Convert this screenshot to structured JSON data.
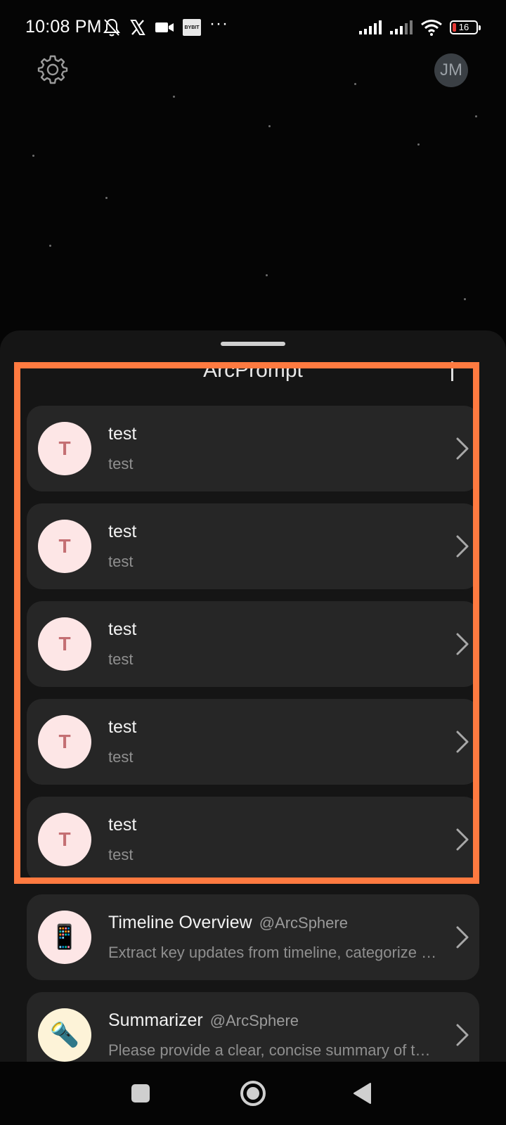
{
  "status_bar": {
    "time": "10:08 PM",
    "left_icons": [
      "bell-off-icon",
      "x-logo-icon",
      "video-camera-icon",
      "bybit-icon",
      "more-dots-icon"
    ],
    "bybit_label": "BYBIT",
    "dots": "···",
    "right_icons": [
      "signal-icon",
      "signal-icon",
      "wifi-icon",
      "battery-icon"
    ],
    "battery_level": "16",
    "battery_color": "#e53935"
  },
  "top_bar": {
    "settings_icon": "gear-icon",
    "avatar_initials": "JM"
  },
  "sheet": {
    "title": "ArcPrompt",
    "add_icon": "plus-icon"
  },
  "prompts": [
    {
      "initial": "T",
      "title": "test",
      "author": "",
      "subtitle": "test"
    },
    {
      "initial": "T",
      "title": "test",
      "author": "",
      "subtitle": "test"
    },
    {
      "initial": "T",
      "title": "test",
      "author": "",
      "subtitle": "test"
    },
    {
      "initial": "T",
      "title": "test",
      "author": "",
      "subtitle": "test"
    },
    {
      "initial": "T",
      "title": "test",
      "author": "",
      "subtitle": "test"
    },
    {
      "initial": "📱",
      "title": "Timeline Overview",
      "author": "@ArcSphere",
      "subtitle": "Extract key updates from timeline, categorize them..."
    },
    {
      "initial": "🔦",
      "title": "Summarizer",
      "author": "@ArcSphere",
      "subtitle": "Please provide a clear, concise summary of the content..."
    }
  ],
  "highlight_color": "#ff7a40",
  "nav_bar": {
    "buttons": [
      "recent-apps-square-icon",
      "home-circle-icon",
      "back-triangle-icon"
    ]
  }
}
